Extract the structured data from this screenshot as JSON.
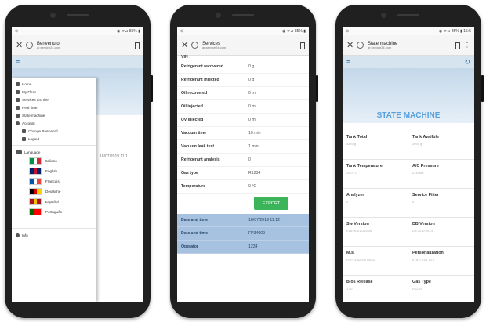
{
  "phone1": {
    "status": "◉ ᯤ⊿ 85% ▮",
    "url_title": "Benvenuto",
    "url_host": "ar.service24.com",
    "hero_word": "NUTO",
    "date_text": "18/07/2019 11:1",
    "menu": [
      {
        "label": "Home",
        "icon": "home-icon"
      },
      {
        "label": "My Fleet",
        "icon": "fleet-icon"
      },
      {
        "label": "Services archive",
        "icon": "archive-icon"
      },
      {
        "label": "Real time",
        "icon": "realtime-icon"
      },
      {
        "label": "State machine",
        "icon": "state-machine-icon"
      },
      {
        "label": "Account",
        "icon": "account-icon"
      }
    ],
    "account_sub": [
      {
        "label": "Change Password",
        "icon": "key-icon"
      },
      {
        "label": "Logout",
        "icon": "lock-icon"
      }
    ],
    "language_label": "Language",
    "languages": [
      {
        "label": "Italiano",
        "colors": [
          "#009246",
          "#ffffff",
          "#ce2b37"
        ]
      },
      {
        "label": "English",
        "colors": [
          "#012169",
          "#c8102e",
          "#012169"
        ]
      },
      {
        "label": "Français",
        "colors": [
          "#0055a4",
          "#ffffff",
          "#ef4135"
        ]
      },
      {
        "label": "Deutsche",
        "colors": [
          "#000000",
          "#dd0000",
          "#ffce00"
        ]
      },
      {
        "label": "Español",
        "colors": [
          "#aa151b",
          "#f1bf00",
          "#aa151b"
        ]
      },
      {
        "label": "Português",
        "colors": [
          "#006600",
          "#ff0000",
          "#ff0000"
        ]
      }
    ],
    "info_label": "Info"
  },
  "phone2": {
    "status": "◉ ᯤ⊿ 85% ▮",
    "url_title": "Services",
    "url_host": "ar.service24.com",
    "top_row": {
      "k": "VIN"
    },
    "rows": [
      {
        "k": "Refrigerant recovered",
        "v": "0 g"
      },
      {
        "k": "Refrigerant injected",
        "v": "0 g"
      },
      {
        "k": "Oil recovered",
        "v": "0 ml"
      },
      {
        "k": "Oil injected",
        "v": "0 ml"
      },
      {
        "k": "UV injected",
        "v": "0 ml"
      },
      {
        "k": "Vacuum time",
        "v": "10 min"
      },
      {
        "k": "Vacuum leak test",
        "v": "1 min"
      },
      {
        "k": "Refrigerant analysis",
        "v": "0"
      },
      {
        "k": "Gas type",
        "v": "R1234"
      },
      {
        "k": "Temperature",
        "v": "0 °C"
      }
    ],
    "export_label": "EXPORT",
    "blue_rows": [
      {
        "k": "Date and time",
        "v": "18/07/2019 11:12"
      },
      {
        "k": "Date and time",
        "v": "FP34009"
      },
      {
        "k": "Operator",
        "v": "1234"
      }
    ]
  },
  "phone3": {
    "status": "◉ ᯤ⊿ 85% ▮ 15:5",
    "url_title": "State machine",
    "url_host": "ar.service24.com",
    "title": "STATE MACHINE",
    "grid": [
      [
        {
          "h": "Tank Total",
          "s": "5493 g"
        },
        {
          "h": "Tank Availble",
          "s": "3093 g"
        }
      ],
      [
        {
          "h": "Tank Temperature",
          "s": "29.0 °C"
        },
        {
          "h": "A/C Pressure",
          "s": "0.00 bar"
        }
      ],
      [
        {
          "h": "Analyzer",
          "s": "0"
        },
        {
          "h": "Service Filter",
          "s": "0"
        }
      ],
      [
        {
          "h": "Sw Version",
          "s": "E16.06.01 D16.06"
        },
        {
          "h": "DB Version",
          "s": "DB 2019.09.01"
        }
      ],
      [
        {
          "h": "M.s.",
          "s": "FRP-0052008 #8022"
        },
        {
          "h": "Personalization",
          "s": "E16.0 P.01 10.0"
        }
      ],
      [
        {
          "h": "Bios Release",
          "s": "1.02"
        },
        {
          "h": "Gas Type",
          "s": "R1234"
        }
      ]
    ]
  }
}
